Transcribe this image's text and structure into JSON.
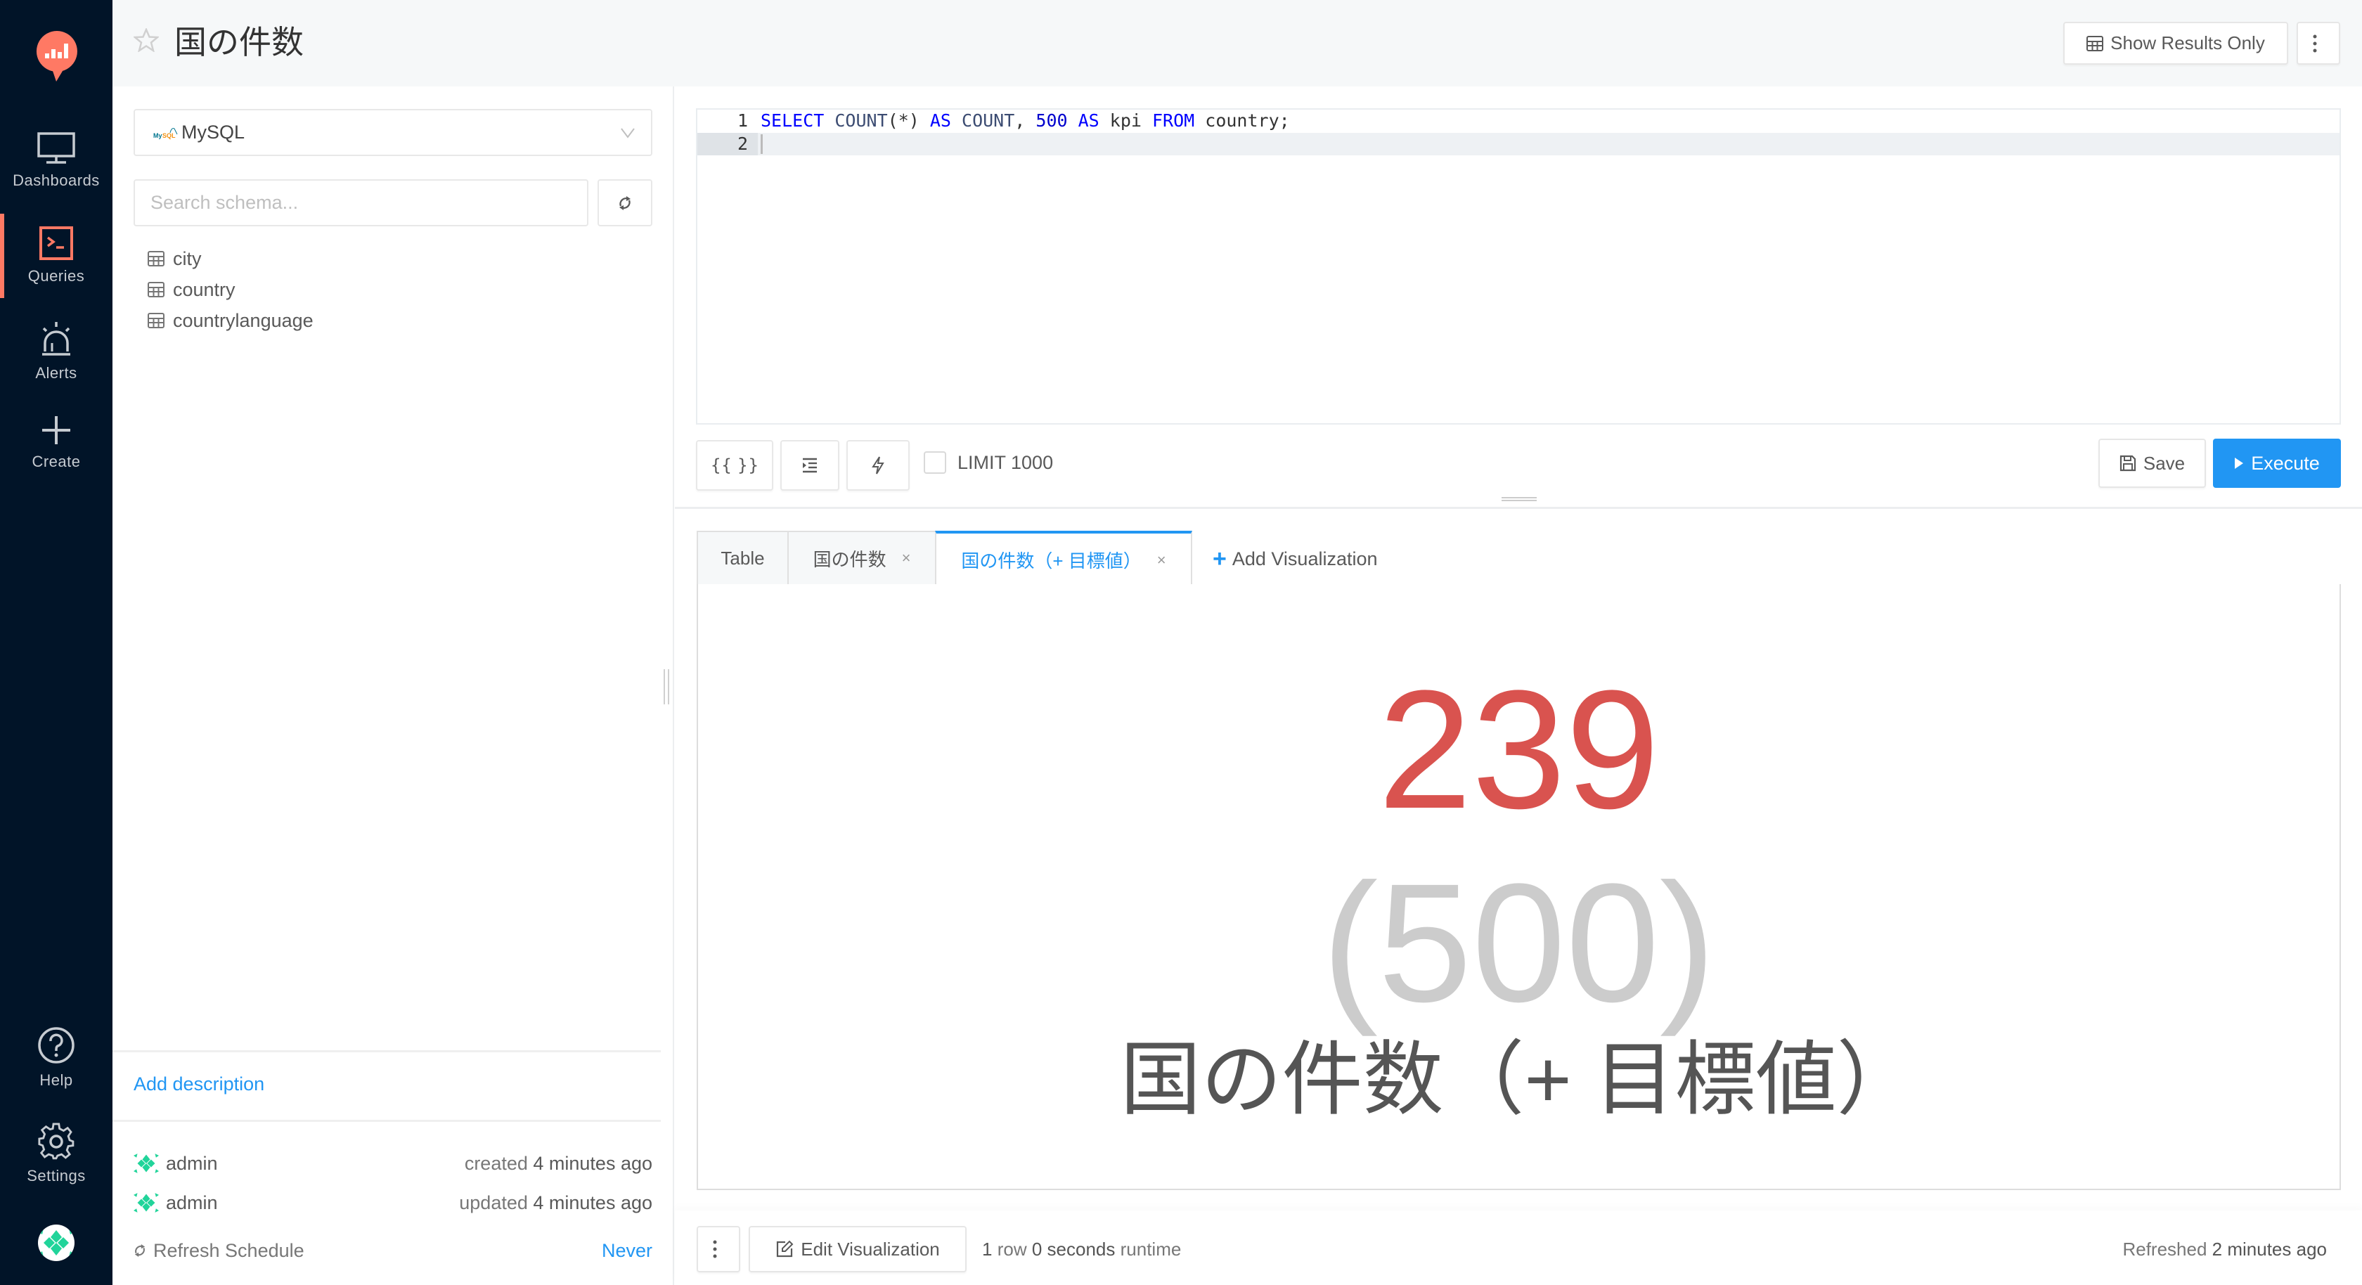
{
  "nav": {
    "items": [
      {
        "label": "Dashboards",
        "icon": "monitor-icon"
      },
      {
        "label": "Queries",
        "icon": "terminal-icon",
        "active": true
      },
      {
        "label": "Alerts",
        "icon": "siren-icon"
      },
      {
        "label": "Create",
        "icon": "plus-icon"
      }
    ],
    "bottom_items": [
      {
        "label": "Help",
        "icon": "help-icon"
      },
      {
        "label": "Settings",
        "icon": "gear-icon"
      }
    ],
    "accent_color": "#ff7964"
  },
  "header": {
    "title": "国の件数",
    "show_results_only_label": "Show Results Only",
    "more_icon": "kebab-icon"
  },
  "left_panel": {
    "datasource": "MySQL",
    "search_placeholder": "Search schema...",
    "search_value": "",
    "schema_tables": [
      "city",
      "country",
      "countrylanguage"
    ],
    "add_description_label": "Add description",
    "created": {
      "user": "admin",
      "prefix": "created",
      "time": "4 minutes ago"
    },
    "updated": {
      "user": "admin",
      "prefix": "updated",
      "time": "4 minutes ago"
    },
    "refresh_schedule_label": "Refresh Schedule",
    "refresh_schedule_value": "Never"
  },
  "editor": {
    "lines": [
      {
        "number": "1",
        "tokens": [
          {
            "t": "SELECT",
            "c": "kw"
          },
          {
            "t": " ",
            "c": ""
          },
          {
            "t": "COUNT",
            "c": "fn"
          },
          {
            "t": "(*) ",
            "c": ""
          },
          {
            "t": "AS",
            "c": "kw"
          },
          {
            "t": " ",
            "c": ""
          },
          {
            "t": "COUNT",
            "c": "fn"
          },
          {
            "t": ", ",
            "c": ""
          },
          {
            "t": "500",
            "c": "num"
          },
          {
            "t": " ",
            "c": ""
          },
          {
            "t": "AS",
            "c": "kw"
          },
          {
            "t": " kpi ",
            "c": ""
          },
          {
            "t": "FROM",
            "c": "kw"
          },
          {
            "t": " country;",
            "c": ""
          }
        ]
      },
      {
        "number": "2",
        "tokens": []
      }
    ],
    "toolbar": {
      "params_label": "{{ }}",
      "format_icon": "indent-icon",
      "autocomplete_icon": "lightning-icon",
      "limit_label": "LIMIT 1000",
      "limit_checked": false,
      "save_label": "Save",
      "execute_label": "Execute"
    }
  },
  "results": {
    "tabs": [
      {
        "label": "Table",
        "closable": false,
        "active": false
      },
      {
        "label": "国の件数",
        "closable": true,
        "active": false
      },
      {
        "label": "国の件数（+ 目標値）",
        "closable": true,
        "active": true
      }
    ],
    "close_glyph": "×",
    "add_visualization_label": "Add Visualization",
    "counter": {
      "value": "239",
      "target": "(500)",
      "label": "国の件数（+ 目標値）",
      "value_color": "#d9534f",
      "target_color": "#cccccc"
    }
  },
  "footer": {
    "edit_visualization_label": "Edit Visualization",
    "rows": "1",
    "rows_suffix": "row",
    "runtime": "0 seconds",
    "runtime_suffix": "runtime",
    "refreshed_prefix": "Refreshed",
    "refreshed_time": "2 minutes ago"
  }
}
